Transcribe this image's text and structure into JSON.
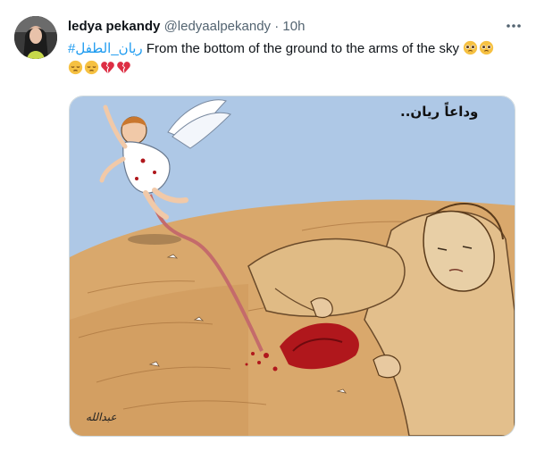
{
  "tweet": {
    "display_name": "ledya pekandy",
    "handle": "@ledyaalpekandy",
    "separator": "·",
    "time": "10h",
    "hashtag": "#ريان_الطفل",
    "text": "From the bottom of the ground to the arms of the sky",
    "emojis_line1": [
      "pleading-face-emoji",
      "pleading-face-emoji"
    ],
    "emojis_line2": [
      "pensive-face-emoji",
      "pensive-face-emoji",
      "broken-heart-emoji",
      "broken-heart-emoji"
    ]
  },
  "media": {
    "caption": "وداعاً ريان..",
    "signature": "عبدالله"
  },
  "colors": {
    "link": "#1d9bf0",
    "secondary_text": "#536471",
    "sky": "#aec8e6",
    "sand": "#d6a266",
    "blood": "#b0171c"
  }
}
